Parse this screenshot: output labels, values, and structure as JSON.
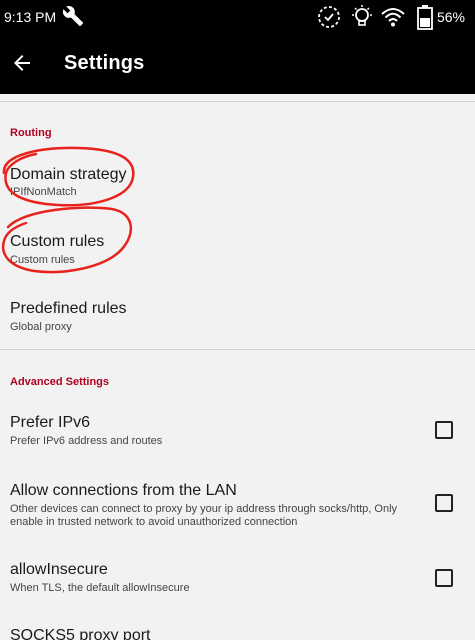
{
  "status_bar": {
    "time": "9:13 PM",
    "battery_percent": "56%",
    "icons": [
      "wrench-icon",
      "sync-icon",
      "lightbulb-icon",
      "wifi-icon",
      "battery-icon"
    ]
  },
  "app_bar": {
    "title": "Settings",
    "back_icon": "arrow-back-icon"
  },
  "sections": {
    "routing": {
      "header": "Routing",
      "items": [
        {
          "title": "Domain strategy",
          "summary": "IPIfNonMatch"
        },
        {
          "title": "Custom rules",
          "summary": "Custom rules"
        },
        {
          "title": "Predefined rules",
          "summary": "Global proxy"
        }
      ]
    },
    "advanced": {
      "header": "Advanced Settings",
      "items": [
        {
          "title": "Prefer IPv6",
          "summary": "Prefer IPv6 address and routes",
          "checked": false
        },
        {
          "title": "Allow connections from the LAN",
          "summary": "Other devices can connect to proxy by your ip address through socks/http, Only enable in trusted network to avoid unauthorized connection",
          "checked": false
        },
        {
          "title": "allowInsecure",
          "summary": "When TLS, the default allowInsecure",
          "checked": false
        },
        {
          "title": "SOCKS5 proxy port"
        }
      ]
    }
  },
  "colors": {
    "section_header": "#b0001f",
    "annotation": "#e8231e",
    "bar_background": "#000000",
    "page_background": "#f2f2f2"
  }
}
